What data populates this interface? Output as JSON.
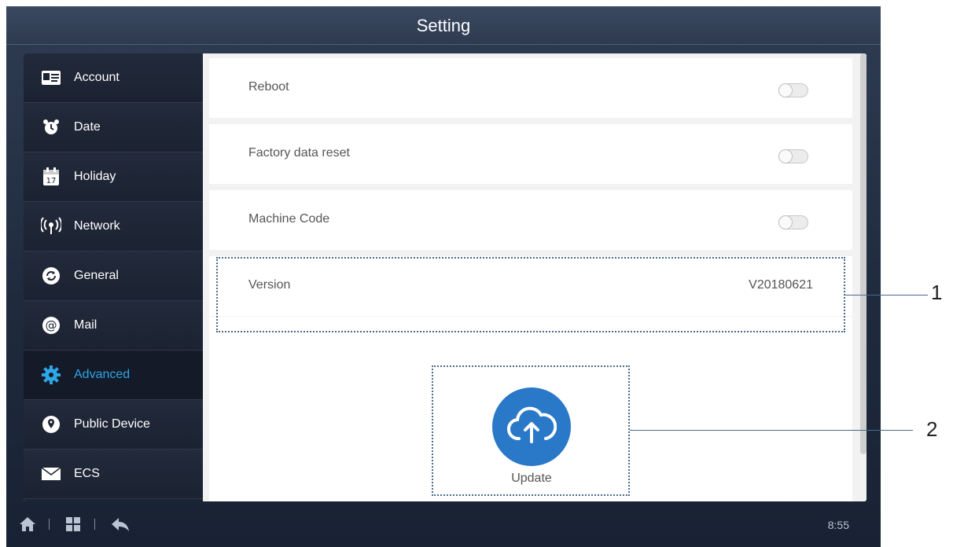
{
  "header": {
    "title": "Setting"
  },
  "sidebar": {
    "items": [
      {
        "label": "Account",
        "icon": "id-card-icon"
      },
      {
        "label": "Date",
        "icon": "alarm-clock-icon"
      },
      {
        "label": "Holiday",
        "icon": "calendar-icon"
      },
      {
        "label": "Network",
        "icon": "antenna-icon"
      },
      {
        "label": "General",
        "icon": "refresh-icon"
      },
      {
        "label": "Mail",
        "icon": "at-sign-icon"
      },
      {
        "label": "Advanced",
        "icon": "gear-icon",
        "active": true
      },
      {
        "label": "Public Device",
        "icon": "location-pin-icon"
      },
      {
        "label": "ECS",
        "icon": "envelope-icon"
      }
    ]
  },
  "settings": {
    "reboot": {
      "label": "Reboot",
      "on": false
    },
    "factory_reset": {
      "label": "Factory data reset",
      "on": false
    },
    "machine_code": {
      "label": "Machine Code",
      "on": false
    },
    "version": {
      "label": "Version",
      "value": "V20180621"
    }
  },
  "update": {
    "label": "Update",
    "icon": "cloud-upload-icon"
  },
  "callouts": [
    "1",
    "2"
  ],
  "footer": {
    "time": "8:55",
    "nav": [
      "home-icon",
      "grid-icon",
      "back-icon"
    ]
  },
  "colors": {
    "accent": "#2ea6e8",
    "update_button": "#2a78c8",
    "sidebar_bg": "#1d2433"
  }
}
